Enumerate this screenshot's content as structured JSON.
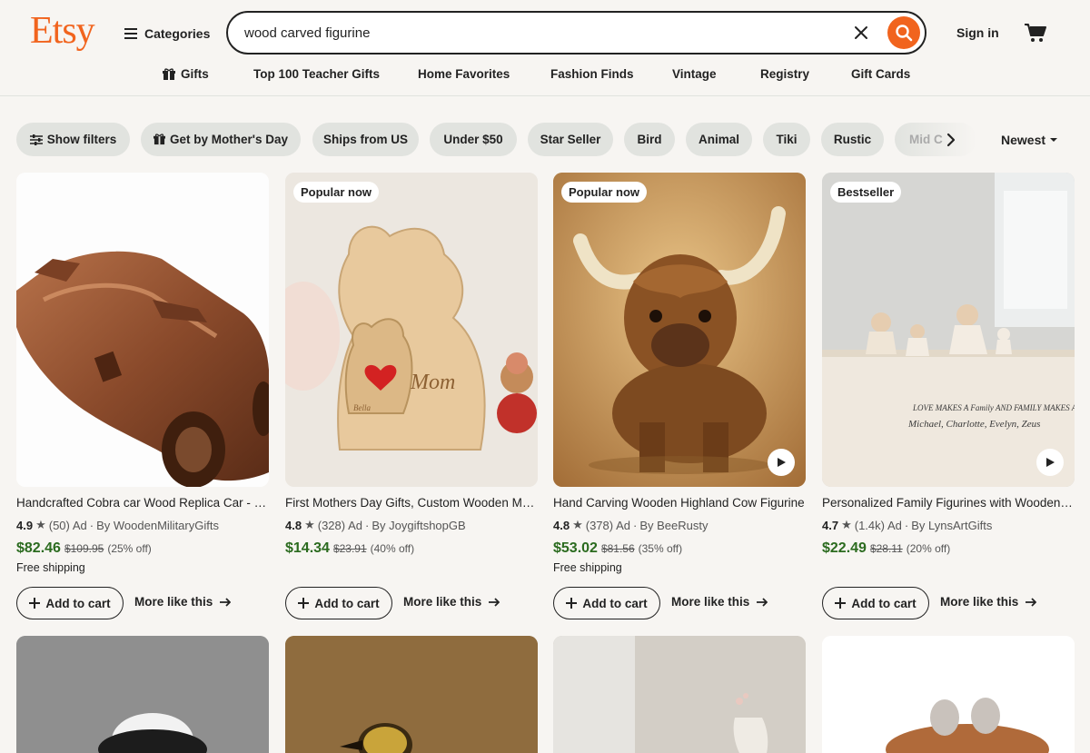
{
  "brand": "Etsy",
  "header": {
    "categories_label": "Categories",
    "search_value": "wood carved figurine",
    "signin_label": "Sign in"
  },
  "nav": [
    {
      "label": "Gifts",
      "icon": "gift-icon"
    },
    {
      "label": "Top 100 Teacher Gifts"
    },
    {
      "label": "Home Favorites"
    },
    {
      "label": "Fashion Finds"
    },
    {
      "label": "Vintage"
    },
    {
      "label": "Registry"
    },
    {
      "label": "Gift Cards"
    }
  ],
  "filters": [
    {
      "label": "Show filters",
      "icon": "filter-sliders-icon"
    },
    {
      "label": "Get by Mother's Day",
      "icon": "gift-icon"
    },
    {
      "label": "Ships from US"
    },
    {
      "label": "Under $50"
    },
    {
      "label": "Star Seller"
    },
    {
      "label": "Bird"
    },
    {
      "label": "Animal"
    },
    {
      "label": "Tiki"
    },
    {
      "label": "Rustic"
    },
    {
      "label": "Mid C"
    }
  ],
  "sort_label": "Newest",
  "colors": {
    "brand": "#f1641e",
    "price": "#2b6b1f",
    "background": "#f7f5f2",
    "chip": "#e1e3df"
  },
  "products": [
    {
      "title": "Handcrafted Cobra car Wood Replica Car - Wooden Car Model",
      "rating": "4.9",
      "reviews": "(50)",
      "ad": "Ad",
      "shop": "By WoodenMilitaryGifts",
      "price": "$82.46",
      "orig_price": "$109.95",
      "discount": "(25% off)",
      "shipping": "Free shipping",
      "badge": "",
      "video": false,
      "add_label": "Add to cart",
      "more_label": "More like this"
    },
    {
      "title": "First Mothers Day Gifts, Custom Wooden Mom Bear Puzzle",
      "rating": "4.8",
      "reviews": "(328)",
      "ad": "Ad",
      "shop": "By JoygiftshopGB",
      "price": "$14.34",
      "orig_price": "$23.91",
      "discount": "(40% off)",
      "shipping": "",
      "badge": "Popular now",
      "video": false,
      "add_label": "Add to cart",
      "more_label": "More like this"
    },
    {
      "title": "Hand Carving Wooden Highland Cow Figurine",
      "rating": "4.8",
      "reviews": "(378)",
      "ad": "Ad",
      "shop": "By BeeRusty",
      "price": "$53.02",
      "orig_price": "$81.56",
      "discount": "(35% off)",
      "shipping": "Free shipping",
      "badge": "Popular now",
      "video": true,
      "add_label": "Add to cart",
      "more_label": "More like this"
    },
    {
      "title": "Personalized Family Figurines with Wooden Sign",
      "rating": "4.7",
      "reviews": "(1.4k)",
      "ad": "Ad",
      "shop": "By LynsArtGifts",
      "price": "$22.49",
      "orig_price": "$28.11",
      "discount": "(20% off)",
      "shipping": "",
      "badge": "Bestseller",
      "video": true,
      "add_label": "Add to cart",
      "more_label": "More like this"
    }
  ],
  "sign_text": {
    "line1": "LOVE MAKES A Family AND FAMILY MAKES A H",
    "line2": "Michael, Charlotte, Evelyn, Zeus"
  },
  "puzzle_text": {
    "mom": "Mom",
    "name": "Bella"
  }
}
